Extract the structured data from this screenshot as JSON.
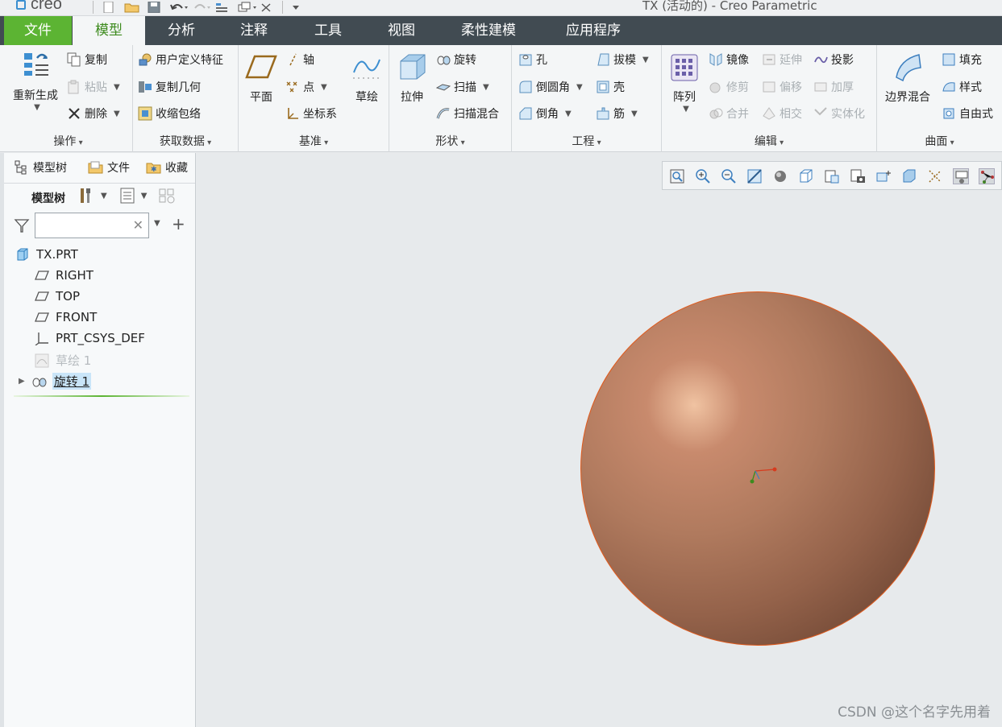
{
  "app": {
    "logo": "creo",
    "window_title": "TX (活动的) - Creo Parametric"
  },
  "tabs": [
    {
      "label": "文件"
    },
    {
      "label": "模型"
    },
    {
      "label": "分析"
    },
    {
      "label": "注释"
    },
    {
      "label": "工具"
    },
    {
      "label": "视图"
    },
    {
      "label": "柔性建模"
    },
    {
      "label": "应用程序"
    }
  ],
  "ribbon": {
    "operations": {
      "label": "操作",
      "regenerate": "重新生成",
      "copy": "复制",
      "paste": "粘贴",
      "delete": "删除"
    },
    "get_data": {
      "label": "获取数据",
      "udf": "用户定义特征",
      "copy_geom": "复制几何",
      "shrinkwrap": "收缩包络"
    },
    "datum": {
      "label": "基准",
      "plane": "平面",
      "axis": "轴",
      "point": "点",
      "csys": "坐标系",
      "sketch": "草绘"
    },
    "shapes": {
      "label": "形状",
      "extrude": "拉伸",
      "revolve": "旋转",
      "sweep": "扫描",
      "swept_blend": "扫描混合"
    },
    "engineering": {
      "label": "工程",
      "hole": "孔",
      "round": "倒圆角",
      "chamfer": "倒角",
      "draft": "拔模",
      "shell": "壳",
      "rib": "筋"
    },
    "editing": {
      "label": "编辑",
      "pattern": "阵列",
      "mirror": "镜像",
      "extend": "延伸",
      "project": "投影",
      "trim": "修剪",
      "offset": "偏移",
      "thicken": "加厚",
      "merge": "合并",
      "intersect": "相交",
      "solidify": "实体化"
    },
    "surfaces": {
      "label": "曲面",
      "boundary_blend": "边界混合",
      "fill": "填充",
      "style": "样式",
      "freestyle": "自由式"
    }
  },
  "panel": {
    "tabs": [
      "模型树",
      "文件",
      "收藏"
    ],
    "tree_header": "模型树",
    "filter_placeholder": "",
    "items": [
      {
        "label": "TX.PRT"
      },
      {
        "label": "RIGHT"
      },
      {
        "label": "TOP"
      },
      {
        "label": "FRONT"
      },
      {
        "label": "PRT_CSYS_DEF"
      },
      {
        "label": "草绘 1"
      },
      {
        "label": "旋转 1"
      }
    ]
  },
  "watermark": "CSDN @这个名字先用着",
  "colors": {
    "file_tab": "#5cb433",
    "tab_bar": "#414b52",
    "model_edge": "#e05a1c"
  }
}
